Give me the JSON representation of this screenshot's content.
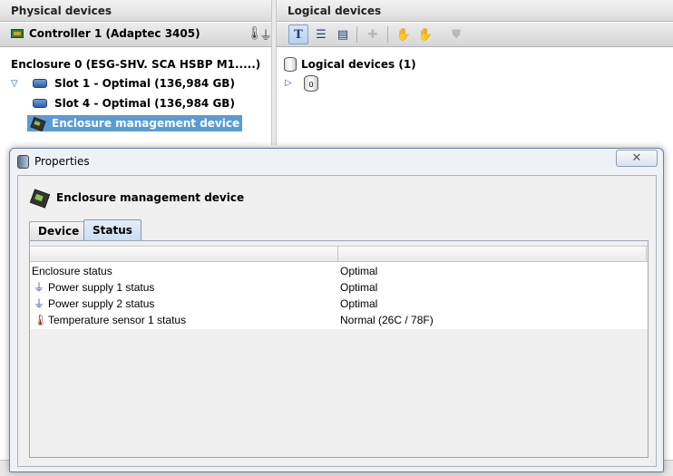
{
  "physical": {
    "header": "Physical devices",
    "controller": "Controller 1 (Adaptec 3405)",
    "enclosure": "Enclosure 0 (ESG-SHV. SCA HSBP M1.....)",
    "items": [
      {
        "label": "Slot 1 - Optimal (136,984 GB)",
        "icon": "disk-icon"
      },
      {
        "label": "Slot 4 - Optimal (136,984 GB)",
        "icon": "disk-icon"
      },
      {
        "label": "Enclosure management device",
        "icon": "chip-icon",
        "selected": true
      }
    ]
  },
  "logical": {
    "header": "Logical devices",
    "title": "Logical devices (1)",
    "disk_label": "0",
    "toolbar": [
      "text-view",
      "list-view",
      "bar-view",
      "add",
      "disabled-1",
      "disabled-2",
      "disabled-3"
    ]
  },
  "properties": {
    "title": "Properties",
    "close_glyph": "✕",
    "device_name": "Enclosure management device",
    "tabs": [
      {
        "label": "Device",
        "active": false
      },
      {
        "label": "Status",
        "active": true
      }
    ],
    "table": {
      "columns": [
        "",
        ""
      ],
      "rows": [
        {
          "name": "Enclosure status",
          "value": "Optimal",
          "icon": ""
        },
        {
          "name": "Power supply 1 status",
          "value": "Optimal",
          "icon": "plug-icon"
        },
        {
          "name": "Power supply 2 status",
          "value": "Optimal",
          "icon": "plug-icon"
        },
        {
          "name": "Temperature sensor 1 status",
          "value": "Normal (26C / 78F)",
          "icon": "thermometer-icon"
        }
      ]
    }
  },
  "colors": {
    "selection": "#5b9bd5",
    "tab_active": "#c9dcf0",
    "plug": "#3a55b5",
    "thermometer": "#8a1a1a"
  }
}
